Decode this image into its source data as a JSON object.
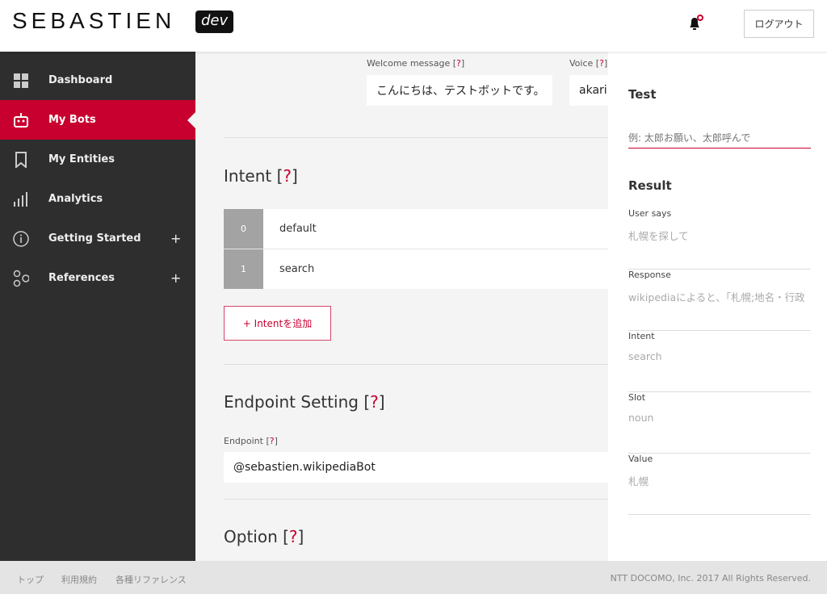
{
  "header": {
    "logo": "SEBASTIEN",
    "logo_badge": "dev",
    "logout_label": "ログアウト",
    "notification_icon": "bell-icon"
  },
  "colors": {
    "accent": "#c8002f",
    "sidebar": "#2e2e2e"
  },
  "sidebar": {
    "items": [
      {
        "label": "Dashboard",
        "icon": "grid-icon"
      },
      {
        "label": "My Bots",
        "icon": "robot-icon",
        "active": true
      },
      {
        "label": "My Entities",
        "icon": "bookmark-icon"
      },
      {
        "label": "Analytics",
        "icon": "bar-signal-icon"
      },
      {
        "label": "Getting Started",
        "icon": "info-icon",
        "expand": "+"
      },
      {
        "label": "References",
        "icon": "nodes-icon",
        "expand": "+"
      }
    ]
  },
  "main": {
    "help": "?",
    "welcome_label": "Welcome message [",
    "welcome_value": "こんにちは、テストボットです。",
    "voice_label": "Voice [",
    "voice_value": "akari",
    "intent_title": "Intent [",
    "intents": [
      {
        "num": "0",
        "name": "default"
      },
      {
        "num": "1",
        "name": "search"
      }
    ],
    "add_intent": "+ Intentを追加",
    "endpoint_title": "Endpoint Setting [",
    "endpoint_label": "Endpoint [",
    "endpoint_value": "@sebastien.wikipediaBot",
    "option_title": "Option ["
  },
  "panel": {
    "test_title": "Test",
    "test_placeholder": "例: 太郎お願い、太郎呼んで",
    "result_title": "Result",
    "fields": [
      {
        "label": "User says",
        "value": "札幌を探して"
      },
      {
        "label": "Response",
        "value": "wikipediaによると、「札幌;地名・行政"
      },
      {
        "label": "Intent",
        "value": "search"
      },
      {
        "label": "Slot",
        "value": "noun"
      },
      {
        "label": "Value",
        "value": "札幌"
      }
    ]
  },
  "footer": {
    "links": [
      "トップ",
      "利用規約",
      "各種リファレンス"
    ],
    "copyright": "NTT DOCOMO, Inc. 2017 All Rights Reserved."
  }
}
